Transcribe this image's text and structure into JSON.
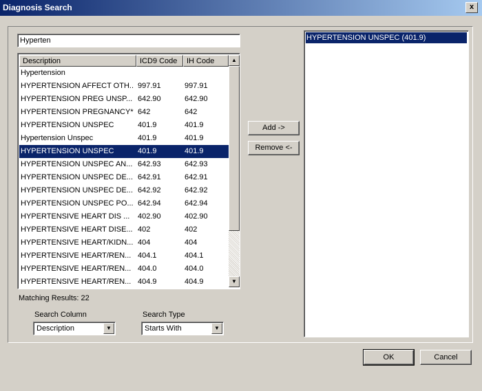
{
  "window": {
    "title": "Diagnosis Search",
    "close_label": "x"
  },
  "search": {
    "value": "Hyperten"
  },
  "table": {
    "columns": [
      "Description",
      "ICD9 Code",
      "IH Code"
    ],
    "rows": [
      {
        "desc": "Hypertension",
        "icd9": "",
        "ih": ""
      },
      {
        "desc": "HYPERTENSION AFFECT OTH...",
        "icd9": "997.91",
        "ih": "997.91"
      },
      {
        "desc": "HYPERTENSION PREG UNSP...",
        "icd9": "642.90",
        "ih": "642.90"
      },
      {
        "desc": "HYPERTENSION PREGNANCY*",
        "icd9": "642",
        "ih": "642"
      },
      {
        "desc": "HYPERTENSION UNSPEC",
        "icd9": "401.9",
        "ih": "401.9"
      },
      {
        "desc": "Hypertension Unspec",
        "icd9": "401.9",
        "ih": "401.9"
      },
      {
        "desc": "HYPERTENSION UNSPEC",
        "icd9": "401.9",
        "ih": "401.9",
        "selected": true
      },
      {
        "desc": "HYPERTENSION UNSPEC AN...",
        "icd9": "642.93",
        "ih": "642.93"
      },
      {
        "desc": "HYPERTENSION UNSPEC DE...",
        "icd9": "642.91",
        "ih": "642.91"
      },
      {
        "desc": "HYPERTENSION UNSPEC DE...",
        "icd9": "642.92",
        "ih": "642.92"
      },
      {
        "desc": "HYPERTENSION UNSPEC PO...",
        "icd9": "642.94",
        "ih": "642.94"
      },
      {
        "desc": "HYPERTENSIVE HEART DIS ...",
        "icd9": "402.90",
        "ih": "402.90"
      },
      {
        "desc": "HYPERTENSIVE HEART DISE...",
        "icd9": "402",
        "ih": "402"
      },
      {
        "desc": "HYPERTENSIVE HEART/KIDN...",
        "icd9": "404",
        "ih": "404"
      },
      {
        "desc": "HYPERTENSIVE HEART/REN...",
        "icd9": "404.1",
        "ih": "404.1"
      },
      {
        "desc": "HYPERTENSIVE HEART/REN...",
        "icd9": "404.0",
        "ih": "404.0"
      },
      {
        "desc": "HYPERTENSIVE HEART/REN...",
        "icd9": "404.9",
        "ih": "404.9"
      }
    ]
  },
  "matching": {
    "label": "Matching Results: 22"
  },
  "search_column": {
    "label": "Search Column",
    "value": "Description"
  },
  "search_type": {
    "label": "Search Type",
    "value": "Starts With"
  },
  "buttons": {
    "add": "Add ->",
    "remove": "Remove <-",
    "ok": "OK",
    "cancel": "Cancel"
  },
  "selected_list": {
    "items": [
      "HYPERTENSION UNSPEC (401.9)"
    ]
  },
  "icons": {
    "scroll_up": "▲",
    "scroll_down": "▼",
    "dropdown": "▼"
  },
  "colors": {
    "selection": "#0a246a",
    "face": "#d4d0c8"
  }
}
